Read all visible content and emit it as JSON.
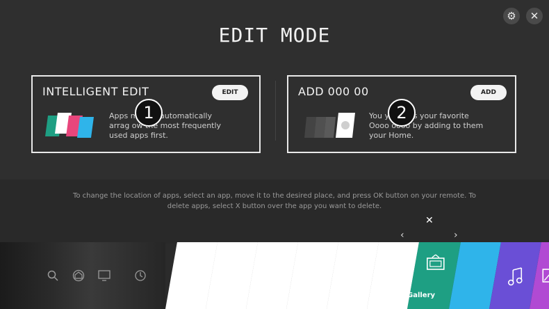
{
  "header": {
    "settings_icon": "gear-icon",
    "close_icon": "close-icon",
    "close_label": "✕",
    "title": "EDIT MODE"
  },
  "cards": {
    "intelligent": {
      "title": "INTELLIGENT EDIT",
      "button_label": "EDIT",
      "badge": "1",
      "text_line1": "Apps     me are automatically",
      "text_line2": "arrag      ow the most frequently",
      "text_line3": "used apps first."
    },
    "add": {
      "title": "ADD 000 00",
      "button_label": "ADD",
      "badge": "2",
      "text_line1": "You      y access your favorite",
      "text_line2": "Oooo      oooo by adding to them",
      "text_line3": "your Home."
    }
  },
  "instructions": "To change the location of apps, select an app, move it to the desired place, and press OK button on your remote. To delete apps, select X button over the app you want to delete.",
  "launcher": {
    "delete_label": "✕",
    "left_arrow": "‹",
    "right_arrow": "›",
    "selected_app_label": "Gallery",
    "tile_colors": {
      "gallery": "#1e9f83",
      "blue": "#2fb4ea",
      "music": "#6a4fd6",
      "photo": "#b14ad3"
    }
  }
}
